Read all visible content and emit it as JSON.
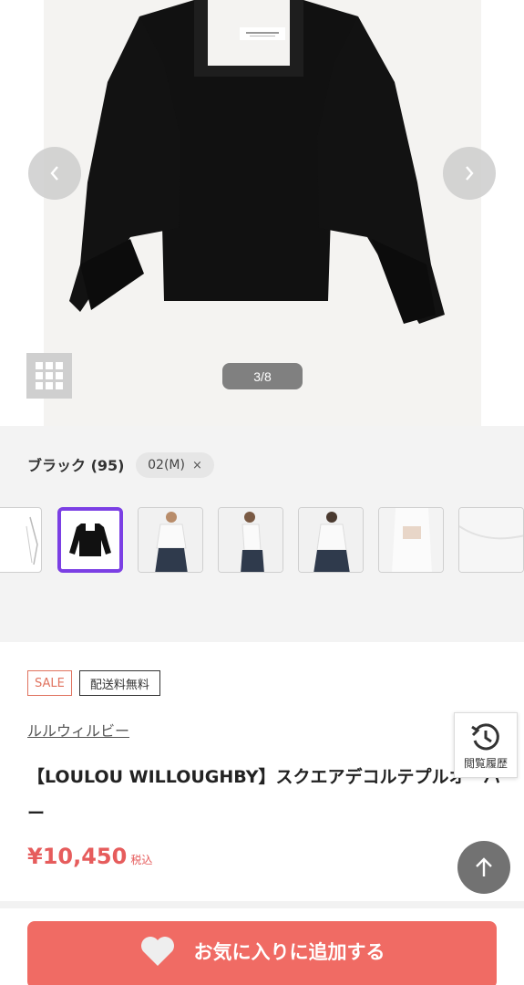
{
  "gallery": {
    "counter": "3/8",
    "prev_icon": "chevron-left-icon",
    "next_icon": "chevron-right-icon",
    "grid_icon": "grid-icon"
  },
  "variant": {
    "color_label": "ブラック (95)",
    "size_chip": "02(M)",
    "size_chip_remove": "×",
    "selected_thumb_index": 1
  },
  "product": {
    "badges": {
      "sale": "SALE",
      "shipping": "配送料無料"
    },
    "brand": "ルルウィルビー",
    "title": "【LOULOU WILLOUGHBY】スクエアデコルテプルオーバー",
    "price": "¥10,450",
    "tax_label": "税込"
  },
  "floating": {
    "history_label": "閲覧履歴",
    "history_icon": "history-icon",
    "top_icon": "arrow-up-icon"
  },
  "cta": {
    "favorite_label": "お気に入りに追加する",
    "favorite_icon": "heart-icon"
  },
  "colors": {
    "accent_purple": "#7b3fe4",
    "sale_red": "#e0735f",
    "price_red": "#e65c5c",
    "cta_red": "#f06b64"
  }
}
